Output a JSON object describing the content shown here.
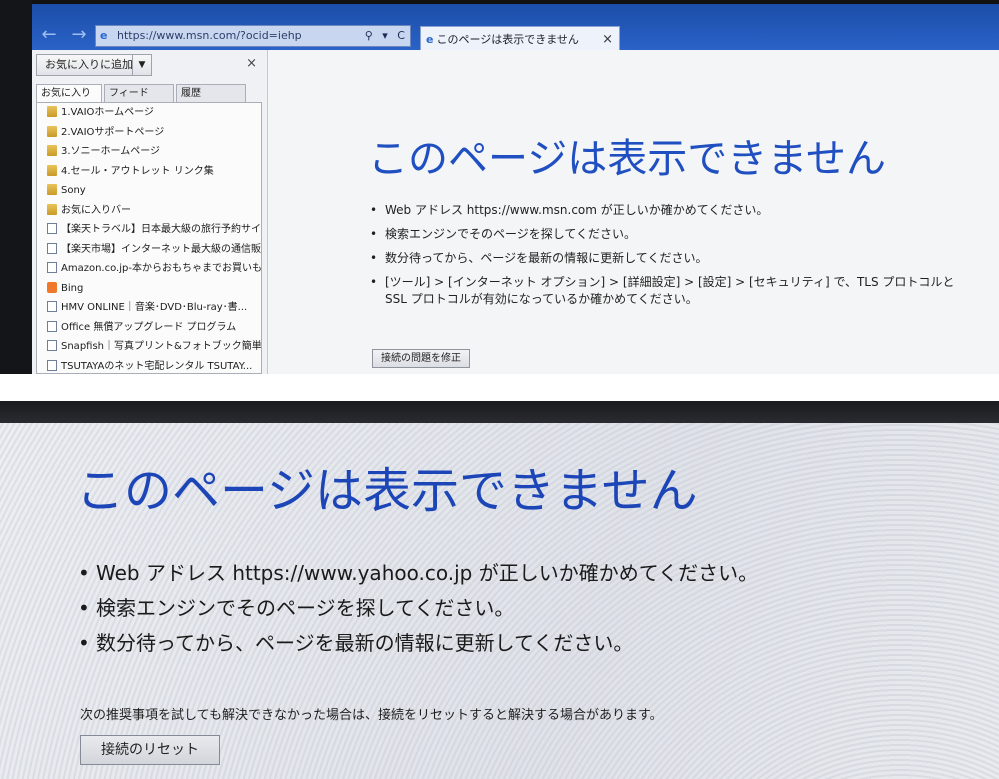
{
  "browser": {
    "address": "https://www.msn.com/?ocid=iehp",
    "tab_title": "このページは表示できません",
    "tab_close": "×",
    "back_glyph": "←",
    "forward_glyph": "→",
    "address_tools": "⚲ ▾ C"
  },
  "favorites_panel": {
    "add_button": "お気に入りに追加",
    "close": "×",
    "tabs": [
      "お気に入り",
      "フィード",
      "履歴"
    ],
    "items": [
      {
        "icon": "folder",
        "label": "1.VAIOホームページ"
      },
      {
        "icon": "folder",
        "label": "2.VAIOサポートページ"
      },
      {
        "icon": "folder",
        "label": "3.ソニーホームページ"
      },
      {
        "icon": "folder",
        "label": "4.セール・アウトレット リンク集"
      },
      {
        "icon": "folder",
        "label": "Sony"
      },
      {
        "icon": "folder",
        "label": "お気に入りバー"
      },
      {
        "icon": "page",
        "label": "【楽天トラベル】日本最大級の旅行予約サイ..."
      },
      {
        "icon": "page",
        "label": "【楽天市場】インターネット最大級の通信販..."
      },
      {
        "icon": "page",
        "label": "Amazon.co.jp-本からおもちゃまでお買いも..."
      },
      {
        "icon": "bing",
        "label": "Bing"
      },
      {
        "icon": "page",
        "label": "HMV ONLINE｜音楽･DVD･Blu-ray･書..."
      },
      {
        "icon": "page",
        "label": "Office 無償アップグレード プログラム"
      },
      {
        "icon": "page",
        "label": "Snapfish｜写真プリント&フォトブック簡単注..."
      },
      {
        "icon": "page",
        "label": "TSUTAYAのネット宅配レンタル TSUTAY..."
      }
    ]
  },
  "top_page": {
    "heading": "このページは表示できません",
    "bullets": [
      "Web アドレス https://www.msn.com が正しいか確かめてください。",
      "検索エンジンでそのページを探してください。",
      "数分待ってから、ページを最新の情報に更新してください。",
      "[ツール] > [インターネット オプション] > [詳細設定] > [設定] > [セキュリティ] で、TLS プロトコルと SSL プロトコルが有効になっているか確かめてください。"
    ],
    "fix_button": "接続の問題を修正"
  },
  "bottom_page": {
    "heading": "このページは表示できません",
    "bullets": [
      "Web アドレス https://www.yahoo.co.jp が正しいか確かめてください。",
      "検索エンジンでそのページを探してください。",
      "数分待ってから、ページを最新の情報に更新してください。"
    ],
    "advice": "次の推奨事項を試しても解決できなかった場合は、接続をリセットすると解決する場合があります。",
    "reset_button": "接続のリセット"
  },
  "colors": {
    "heading_blue": "#1f4fc0",
    "titlebar_blue": "#2a62c7"
  }
}
